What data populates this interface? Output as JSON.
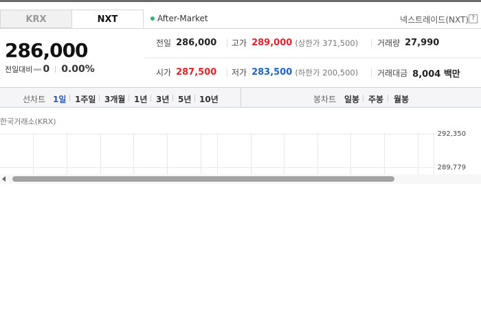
{
  "tabs": {
    "krx": "KRX",
    "nxt": "NXT"
  },
  "market_status": "After-Market",
  "provider_label": "넥스트레이드(NXT)",
  "help_glyph": "?",
  "summary": {
    "price": "286,000",
    "change_label": "전일대비",
    "change_value": "0",
    "change_rate": "0.00%"
  },
  "stats": {
    "prev_close": {
      "label": "전일",
      "value": "286,000"
    },
    "high": {
      "label": "고가",
      "value": "289,000",
      "limit_label": "(상한가 371,500)"
    },
    "volume": {
      "label": "거래량",
      "value": "27,990"
    },
    "open": {
      "label": "시가",
      "value": "287,500"
    },
    "low": {
      "label": "저가",
      "value": "283,500",
      "limit_label": "(하한가 200,500)"
    },
    "amount": {
      "label": "거래대금",
      "value": "8,004 백만"
    }
  },
  "chart_tabs": {
    "line_label": "선차트",
    "line_periods": [
      "1일",
      "1주일",
      "3개월",
      "1년",
      "3년",
      "5년",
      "10년"
    ],
    "active_period": "1일",
    "candle_label": "봉차트",
    "candle_periods": [
      "일봉",
      "주봉",
      "월봉"
    ]
  },
  "chart_caption": "한국거래소(KRX)",
  "y_ticks": [
    "292,350",
    "289,779"
  ],
  "colors": {
    "up": "#e0232b",
    "down": "#1d64c7",
    "active_tab": "#2c57b2",
    "status_dot": "#2bb673"
  }
}
